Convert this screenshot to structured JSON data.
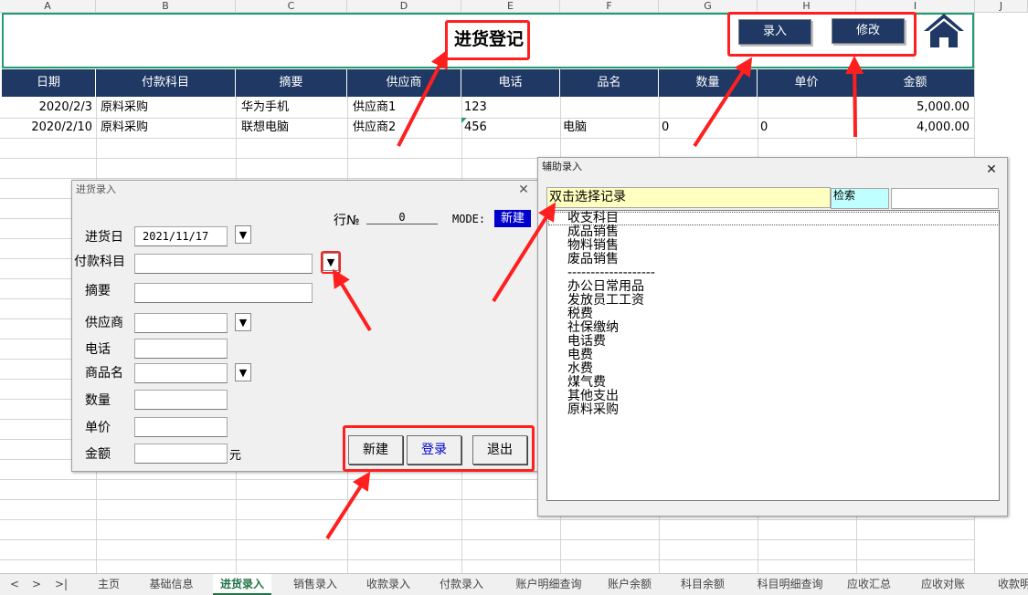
{
  "columns": [
    "A",
    "B",
    "C",
    "D",
    "E",
    "F",
    "G",
    "H",
    "I",
    "J"
  ],
  "sheet": {
    "title": "进货登记",
    "btn_entry": "录入",
    "btn_modify": "修改",
    "headers": [
      "日期",
      "付款科目",
      "摘要",
      "供应商",
      "电话",
      "品名",
      "数量",
      "单价",
      "金额"
    ],
    "rows": [
      [
        "2020/2/3",
        "原料采购",
        "华为手机",
        "供应商1",
        "123",
        "",
        "",
        "",
        "5,000.00"
      ],
      [
        "2020/2/10",
        "原料采购",
        "联想电脑",
        "供应商2",
        "456",
        "电脑",
        "0",
        "0",
        "4,000.00"
      ]
    ]
  },
  "form": {
    "title": "进货录入",
    "row_label": "行№",
    "row_value": "0",
    "mode_label": "MODE:",
    "mode_value": "新建",
    "date_label": "进货日",
    "date_value": "2021/11/17",
    "account_label": "付款科目",
    "summary_label": "摘要",
    "supplier_label": "供应商",
    "phone_label": "电话",
    "product_label": "商品名",
    "qty_label": "数量",
    "price_label": "单价",
    "amount_label": "金额",
    "amount_unit": "元",
    "btn_new": "新建",
    "btn_login": "登录",
    "btn_exit": "退出"
  },
  "helper": {
    "title": "辅助录入",
    "hint": "双击选择记录",
    "search_label": "检索",
    "items": [
      "收支科目",
      "成品销售",
      "物料销售",
      "废品销售",
      "-------------------",
      "办公日常用品",
      "发放员工工资",
      "税费",
      "社保缴纳",
      "电话费",
      "电费",
      "水费",
      "煤气费",
      "其他支出",
      "原料采购"
    ]
  },
  "tabs": [
    "主页",
    "基础信息",
    "进货录入",
    "销售录入",
    "收款录入",
    "付款录入",
    "账户明细查询",
    "账户余额",
    "科目余额",
    "科目明细查询",
    "应收汇总",
    "应收对账",
    "收款明"
  ],
  "active_tab": "进货录入",
  "colors": {
    "header_blue": "#1f3864",
    "accent_red": "#ff1f1f",
    "excel_green": "#217346"
  }
}
